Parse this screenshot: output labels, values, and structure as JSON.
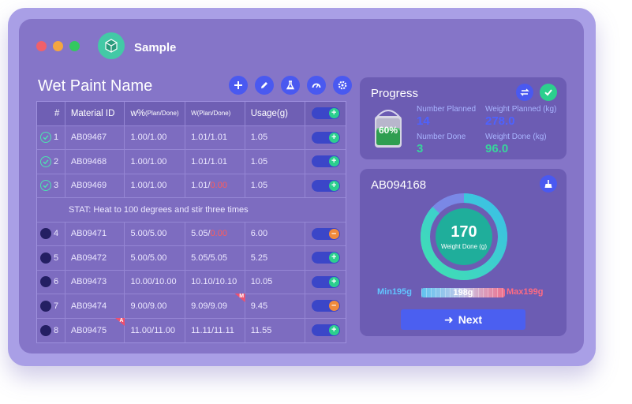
{
  "window": {
    "traffic_lights": {
      "close": "#f0606a",
      "minimize": "#f4a640",
      "maximize": "#33c860"
    },
    "app_title": "Sample",
    "logo_icon": "box-icon"
  },
  "page": {
    "title": "Wet Paint Name",
    "toolbar": [
      {
        "icon": "plus-icon"
      },
      {
        "icon": "edit-icon"
      },
      {
        "icon": "flask-icon"
      },
      {
        "icon": "gauge-icon"
      },
      {
        "icon": "settings-icon"
      }
    ]
  },
  "table": {
    "headers": {
      "index": "#",
      "material": "Material ID",
      "w_pct": "w%",
      "w_pct_sub": "(Plan/Done)",
      "w": "W",
      "w_sub": "(Plan/Done)",
      "usage": "Usage(g)"
    },
    "rows": [
      {
        "index": "1",
        "status": "done",
        "material": "AB09467",
        "w_pct": "1.00/1.00",
        "w_plan": "1.01/",
        "w_done": "1.01",
        "w_done_alert": false,
        "usage": "1.05",
        "toggle": "plus"
      },
      {
        "index": "2",
        "status": "done",
        "material": "AB09468",
        "w_pct": "1.00/1.00",
        "w_plan": "1.01/",
        "w_done": "1.01",
        "w_done_alert": false,
        "usage": "1.05",
        "toggle": "plus"
      },
      {
        "index": "3",
        "status": "done",
        "material": "AB09469",
        "w_pct": "1.00/1.00",
        "w_plan": "1.01/",
        "w_done": "0.00",
        "w_done_alert": true,
        "usage": "1.05",
        "toggle": "plus"
      },
      {
        "index": "4",
        "status": "pending",
        "material": "AB09471",
        "w_pct": "5.00/5.00",
        "w_plan": "5.05/",
        "w_done": "0.00",
        "w_done_alert": true,
        "usage": "6.00",
        "toggle": "minus"
      },
      {
        "index": "5",
        "status": "pending",
        "material": "AB09472",
        "w_pct": "5.00/5.00",
        "w_plan": "5.05/",
        "w_done": "5.05",
        "w_done_alert": false,
        "usage": "5.25",
        "toggle": "plus"
      },
      {
        "index": "6",
        "status": "pending",
        "material": "AB09473",
        "w_pct": "10.00/10.00",
        "w_plan": "10.10/",
        "w_done": "10.10",
        "w_done_alert": false,
        "usage": "10.05",
        "toggle": "plus"
      },
      {
        "index": "7",
        "status": "pending",
        "material": "AB09474",
        "w_pct": "9.00/9.00",
        "w_plan": "9.09/",
        "w_done": "9.09",
        "w_done_alert": false,
        "usage": "9.45",
        "toggle": "minus",
        "flag": "M"
      },
      {
        "index": "8",
        "status": "pending",
        "material": "AB09475",
        "w_pct": "11.00/11.00",
        "w_plan": "11.11/",
        "w_done": "11.11",
        "w_done_alert": false,
        "usage": "11.55",
        "toggle": "plus",
        "flag": "A"
      }
    ],
    "stat_note": "STAT: Heat to 100 degrees and stir three times",
    "stat_after_row": 3
  },
  "progress": {
    "title": "Progress",
    "percent_label": "60%",
    "fill_fraction": 0.6,
    "number_planned_label": "Number Planned",
    "number_planned": "14",
    "weight_planned_label": "Weight Planned (kg)",
    "weight_planned": "278.0",
    "number_done_label": "Number Done",
    "number_done": "3",
    "weight_done_label": "Weight Done (kg)",
    "weight_done": "96.0",
    "colors": {
      "planned": "#4d62ff",
      "done": "#38d49c"
    }
  },
  "weighing": {
    "material_id": "AB094168",
    "weight_value": "170",
    "weight_label": "Weight Done (g)",
    "donut_fraction": 0.87,
    "min_label": "Min195g",
    "max_label": "Max199g",
    "current_label": "198g",
    "next_label": "Next",
    "next_arrow": "➜"
  }
}
